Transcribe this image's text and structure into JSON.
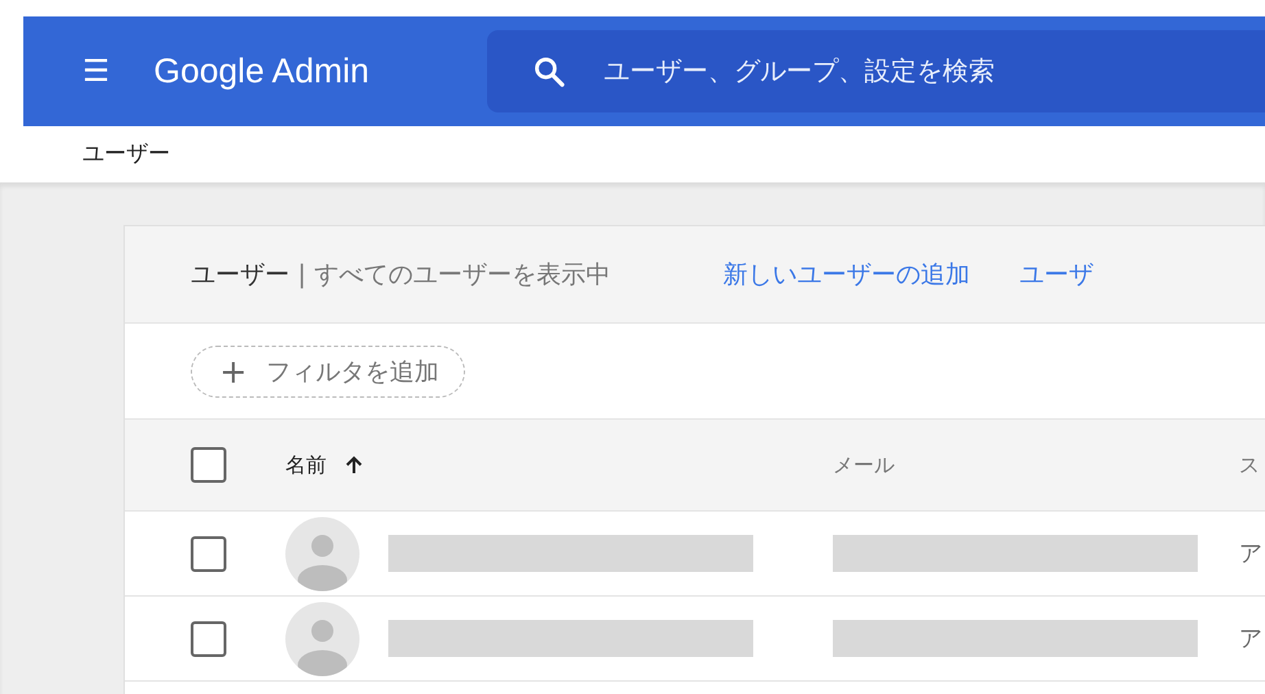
{
  "app_bar": {
    "menu": "☰",
    "logo": "Google Admin",
    "search": {
      "placeholder": "ユーザー、グループ、設定を検索"
    }
  },
  "breadcrumb": "ユーザー",
  "card": {
    "title": "ユーザー",
    "subtitle": "| すべてのユーザーを表示中",
    "actions": [
      "新しいユーザーの追加",
      "ユーザ"
    ],
    "filter": {
      "icon": "+",
      "label": "フィルタを追加"
    },
    "table": {
      "select_all": {
        "checked": false
      },
      "columns": [
        {
          "label": "名前",
          "sorted": true
        },
        {
          "label": "メール"
        },
        {
          "label": "ス"
        }
      ],
      "rows": [
        {
          "checked": false,
          "status": "ア"
        },
        {
          "checked": false,
          "status": "ア"
        }
      ]
    }
  }
}
